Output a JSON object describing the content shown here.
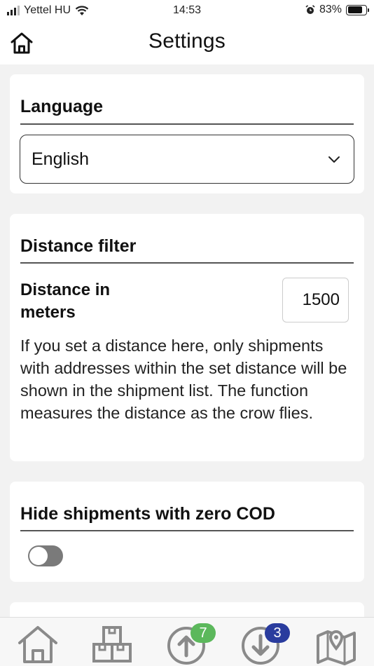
{
  "status_bar": {
    "carrier": "Yettel HU",
    "time": "14:53",
    "battery_percent": "83%",
    "battery_level": 0.83
  },
  "header": {
    "title": "Settings",
    "home_icon": "home-icon"
  },
  "language": {
    "title": "Language",
    "selected": "English"
  },
  "distance_filter": {
    "title": "Distance filter",
    "label": "Distance in meters",
    "value": "1500",
    "description": "If you set a distance here, only shipments with addresses within the set distance will be shown in the shipment list. The function measures the distance as the crow flies."
  },
  "zero_cod": {
    "title": "Hide shipments with zero COD",
    "enabled": false
  },
  "tabbar": {
    "items": [
      {
        "icon": "home-icon"
      },
      {
        "icon": "packages-icon"
      },
      {
        "icon": "upload-icon",
        "badge": "7",
        "badge_color": "#5cb85c"
      },
      {
        "icon": "download-icon",
        "badge": "3",
        "badge_color": "#2a3c9e"
      },
      {
        "icon": "map-icon"
      }
    ]
  }
}
